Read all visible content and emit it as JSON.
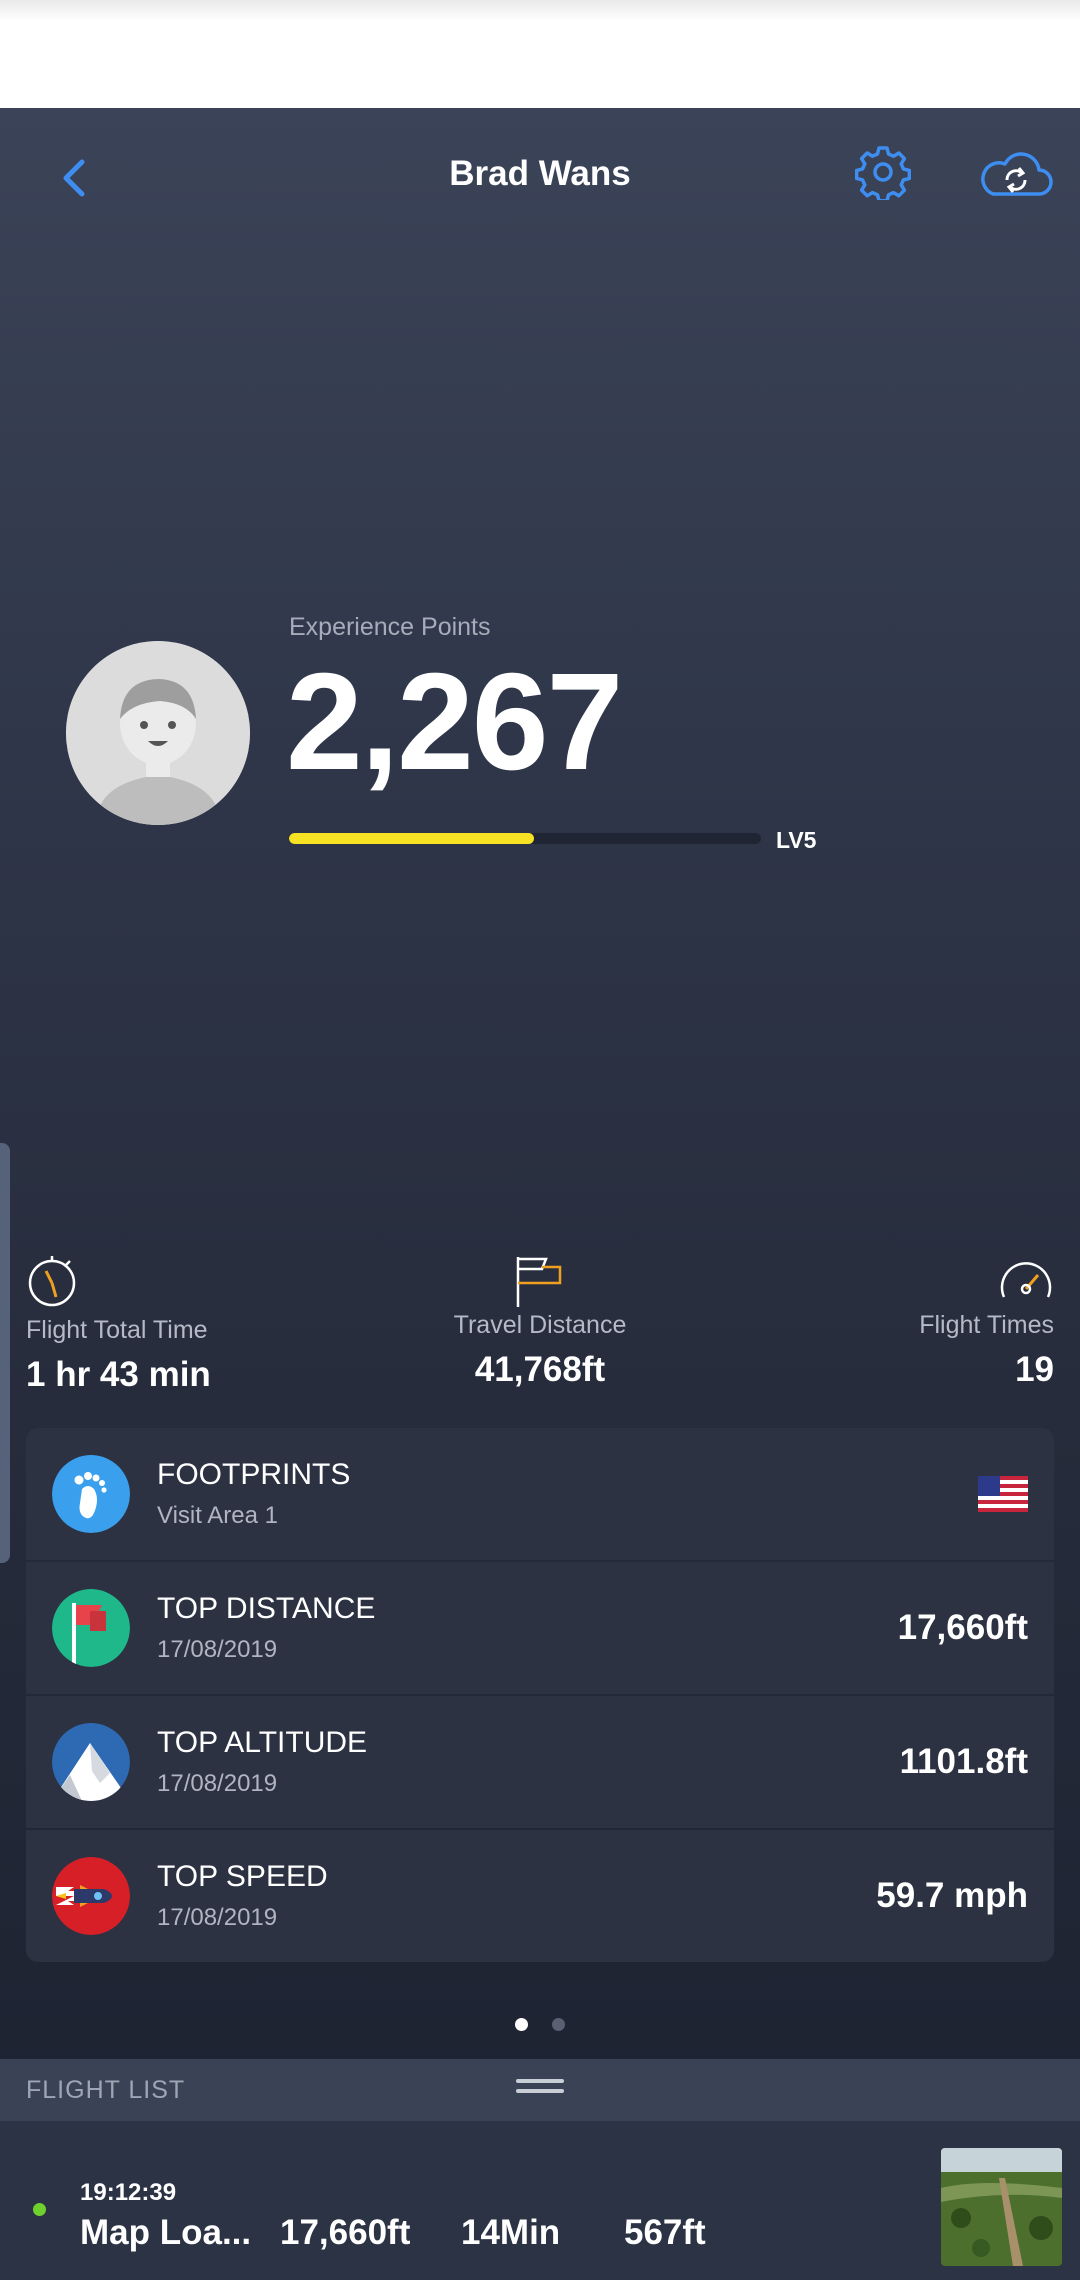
{
  "header": {
    "title": "Brad Wans",
    "accent_color": "#3e8ef1"
  },
  "profile": {
    "xp_label": "Experience Points",
    "xp_value": "2,267",
    "level_label": "LV5",
    "level_progress": 0.52,
    "progress_color": "#f7e323"
  },
  "stats": [
    {
      "icon": "stopwatch-icon",
      "label": "Flight Total Time",
      "value": "1 hr 43 min"
    },
    {
      "icon": "flag-icon",
      "label": "Travel Distance",
      "value": "41,768ft"
    },
    {
      "icon": "speedometer-icon",
      "label": "Flight Times",
      "value": "19"
    }
  ],
  "records": [
    {
      "icon": "footprint-icon",
      "title": "FOOTPRINTS",
      "subtitle": "Visit Area 1",
      "value": "",
      "flag": "us-flag-icon"
    },
    {
      "icon": "red-flag-icon",
      "title": "TOP DISTANCE",
      "subtitle": "17/08/2019",
      "value": "17,660ft"
    },
    {
      "icon": "mountain-icon",
      "title": "TOP ALTITUDE",
      "subtitle": "17/08/2019",
      "value": "1101.8ft"
    },
    {
      "icon": "rocket-icon",
      "title": "TOP SPEED",
      "subtitle": "17/08/2019",
      "value": "59.7 mph"
    }
  ],
  "pager": {
    "current": 1,
    "total": 2
  },
  "flight_list": {
    "title": "FLIGHT LIST",
    "items": [
      {
        "time": "19:12:39",
        "location": "Map Loa...",
        "distance": "17,660ft",
        "duration": "14Min",
        "altitude": "567ft",
        "status_color": "#6fd12e"
      }
    ]
  }
}
